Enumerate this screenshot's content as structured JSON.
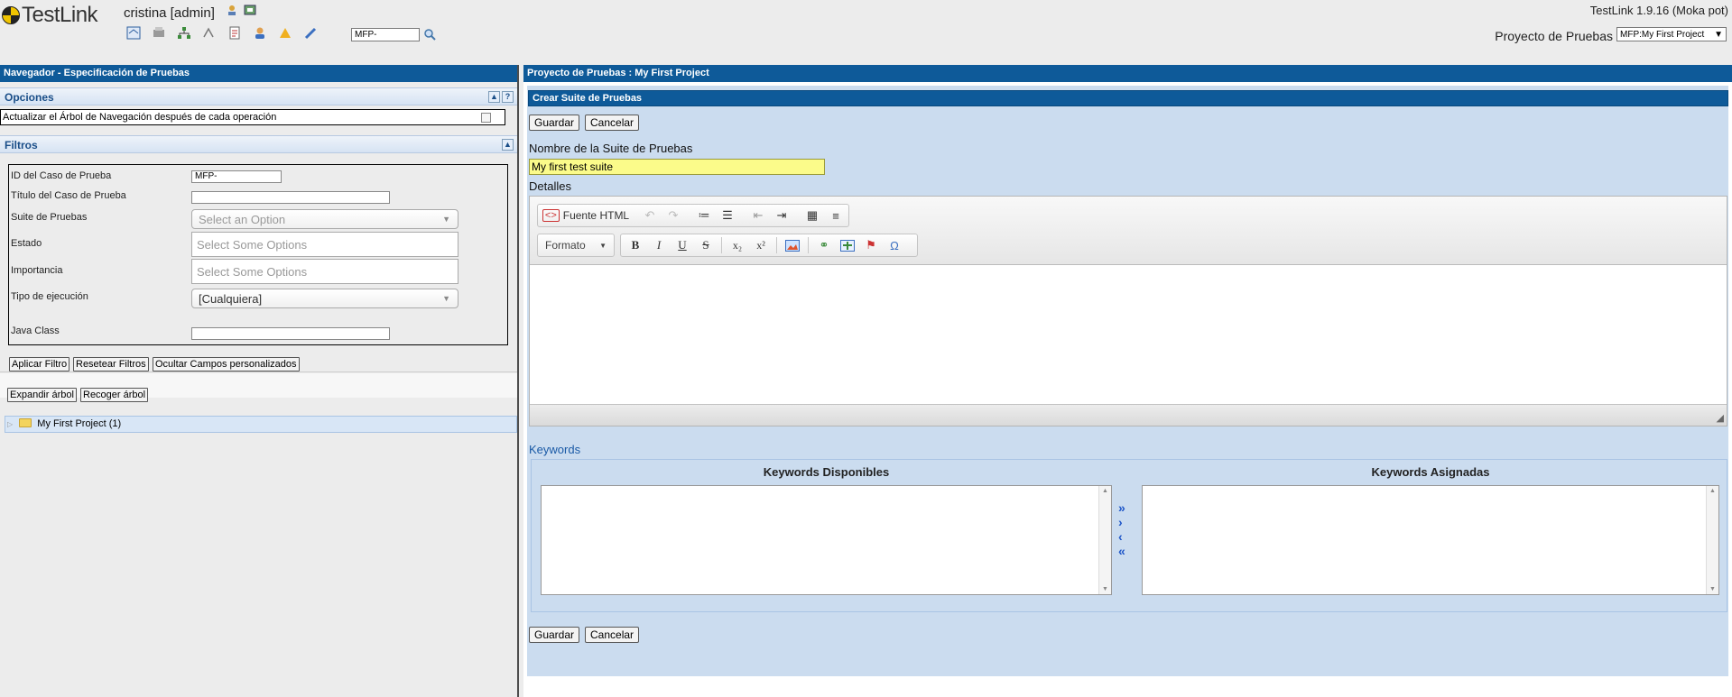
{
  "header": {
    "logo_text": "TestLink",
    "user": "cristina [admin]",
    "quick_search_value": "MFP-",
    "version": "TestLink 1.9.16 (Moka pot)",
    "project_label": "Proyecto de Pruebas",
    "project_selected": "MFP:My First Project"
  },
  "left": {
    "title": "Navegador - Especificación de Pruebas",
    "options": {
      "heading": "Opciones",
      "collapse": "▲",
      "help": "?",
      "refresh_label": "Actualizar el Árbol de Navegación después de cada operación"
    },
    "filters": {
      "heading": "Filtros",
      "collapse": "▲",
      "tc_id_label": "ID del Caso de Prueba",
      "tc_id_value": "MFP-",
      "tc_title_label": "Título del Caso de Prueba",
      "suite_label": "Suite de Pruebas",
      "suite_value": "Select an Option",
      "status_label": "Estado",
      "status_placeholder": "Select Some Options",
      "importance_label": "Importancia",
      "importance_placeholder": "Select Some Options",
      "exec_type_label": "Tipo de ejecución",
      "exec_type_value": "[Cualquiera]",
      "java_class_label": "Java Class"
    },
    "buttons": {
      "apply": "Aplicar Filtro",
      "reset": "Resetear Filtros",
      "hide_custom": "Ocultar Campos personalizados",
      "expand": "Expandir árbol",
      "collapse": "Recoger árbol"
    },
    "tree": {
      "root": "My First Project (1)"
    }
  },
  "right": {
    "title": "Proyecto de Pruebas : My First Project",
    "section_title": "Crear Suite de Pruebas",
    "save": "Guardar",
    "cancel": "Cancelar",
    "name_label": "Nombre de la Suite de Pruebas",
    "name_value": "My first test suite",
    "details_label": "Detalles",
    "editor": {
      "source_label": "Fuente HTML",
      "format_label": "Formato"
    },
    "keywords": {
      "heading": "Keywords",
      "available": "Keywords Disponibles",
      "assigned": "Keywords Asignadas"
    }
  }
}
